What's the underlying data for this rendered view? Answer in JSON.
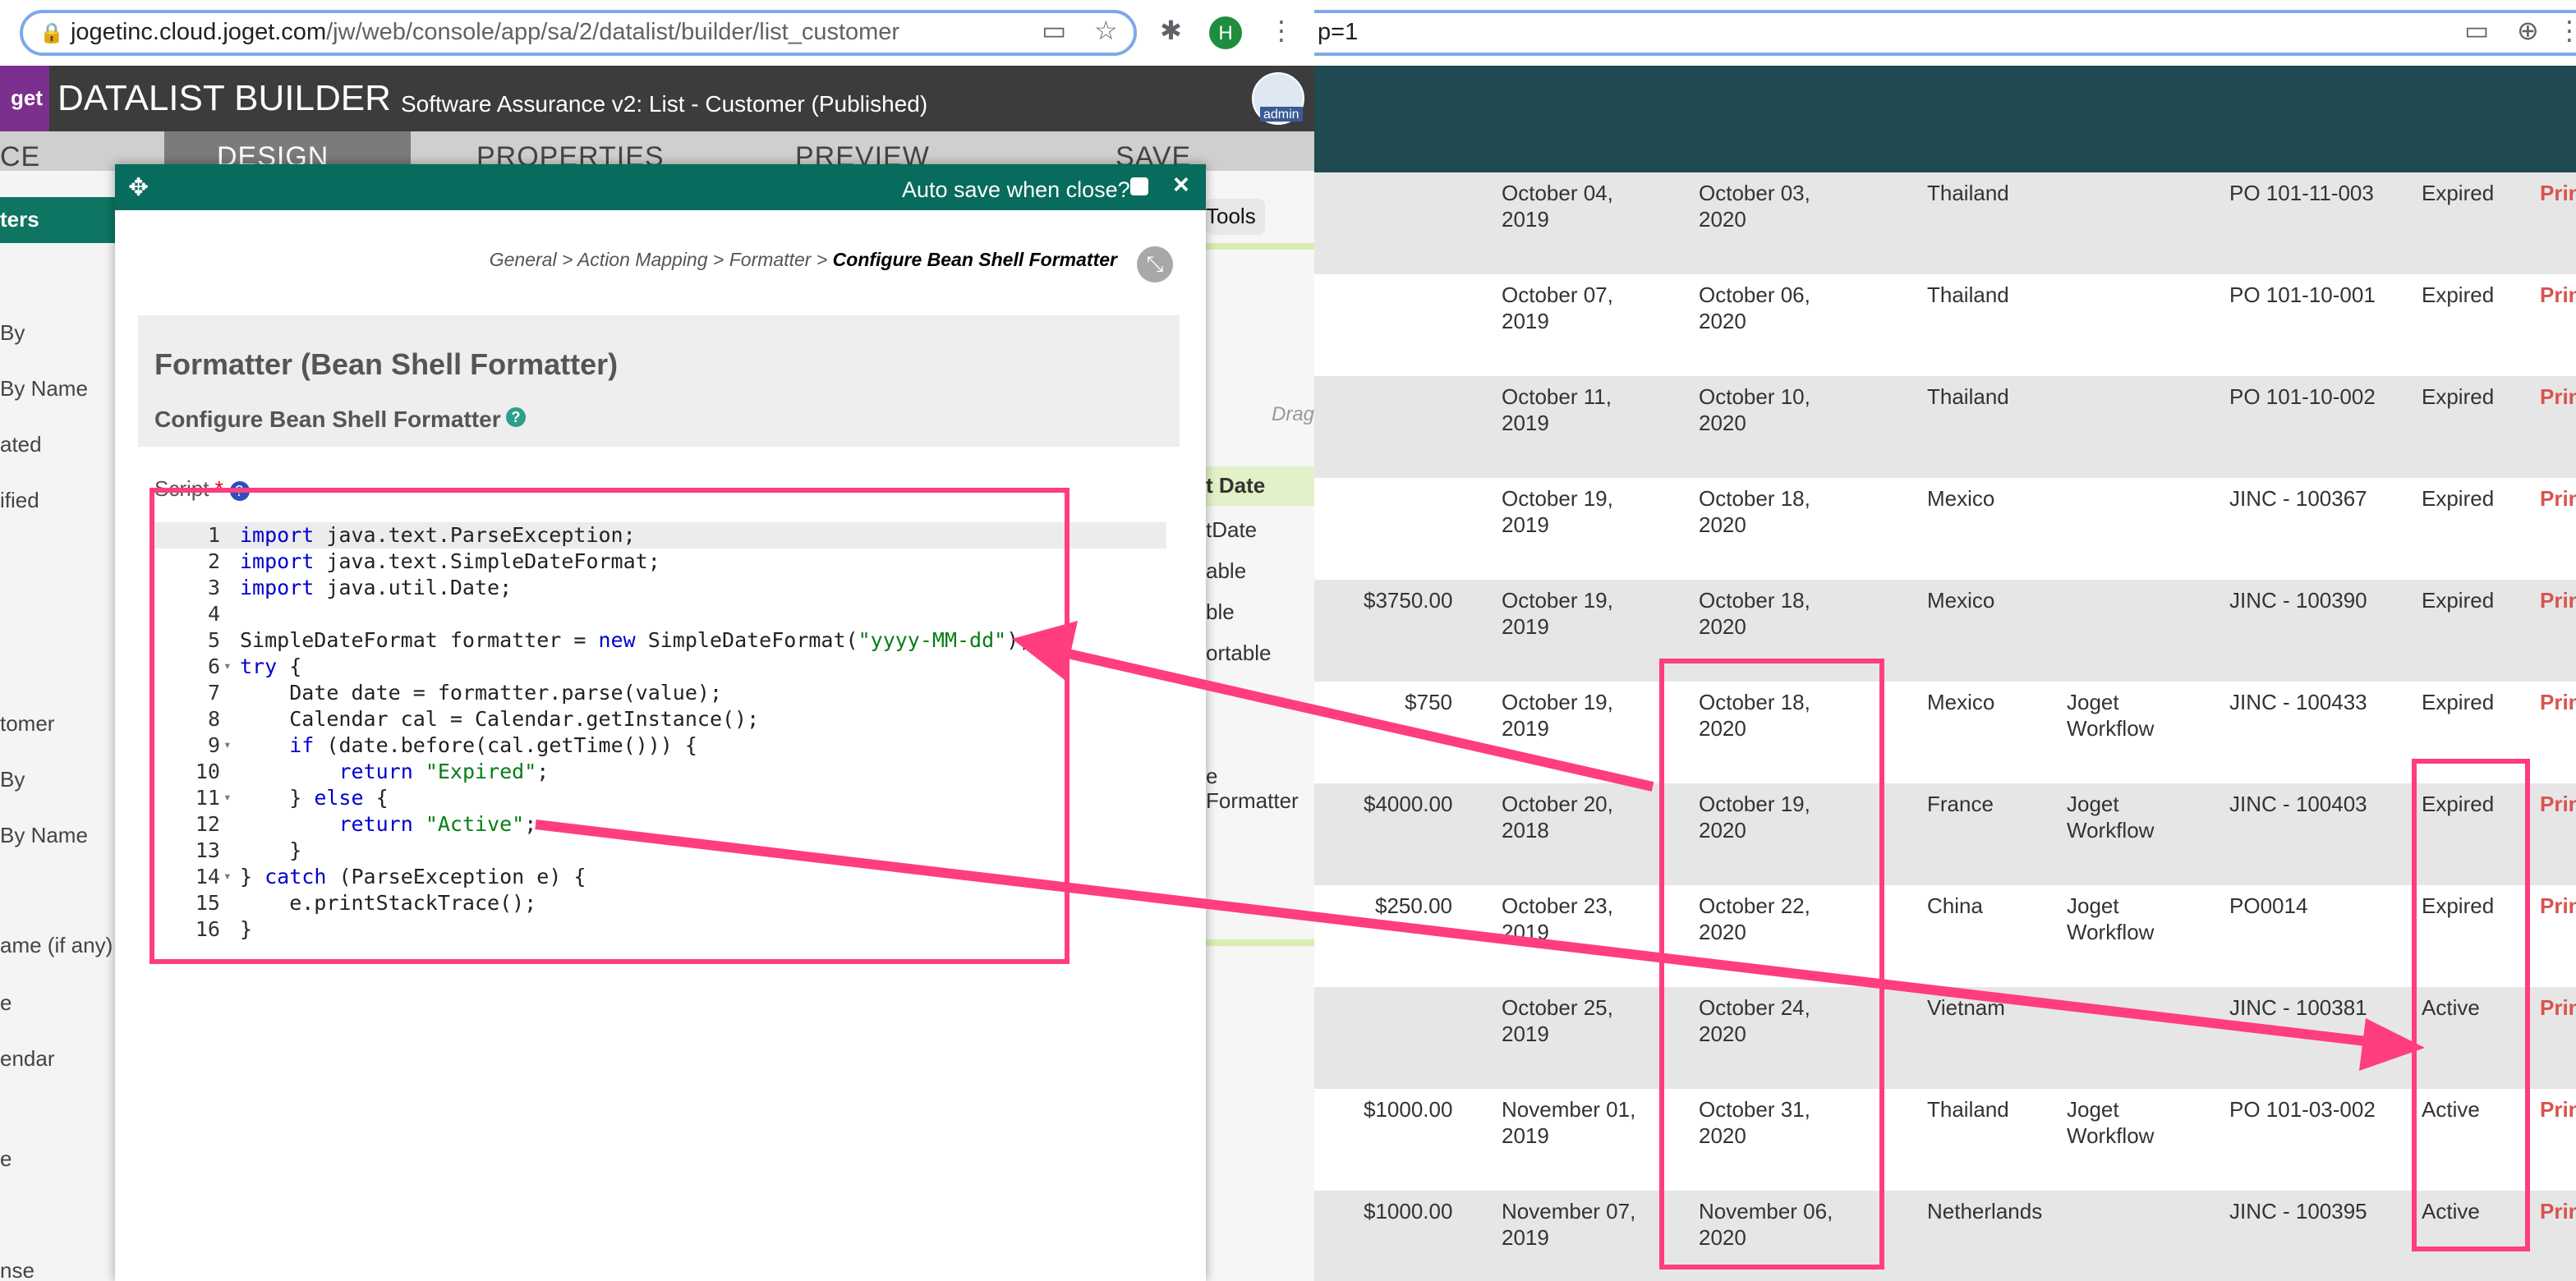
{
  "browser_left": {
    "url_host": "jogetinc.cloud.joget.com",
    "url_path": "/jw/web/console/app/sa/2/datalist/builder/list_customer",
    "profile_initial": "H"
  },
  "browser_right": {
    "url_fragment": "p=1"
  },
  "builder": {
    "logo_text": "get",
    "title": "DATALIST BUILDER",
    "subtitle": "Software Assurance v2: List - Customer (Published)",
    "avatar_label": "admin",
    "tabs": [
      "CE",
      "DESIGN",
      "PROPERTIES",
      "PREVIEW",
      "SAVE"
    ]
  },
  "sidebar": {
    "header": "ters",
    "items": [
      "By",
      "By Name",
      "ated",
      "ified",
      "tomer",
      "By",
      "By Name",
      "ame (if any)",
      "e",
      "endar",
      "e",
      "nse"
    ]
  },
  "middle": {
    "tools_label": "Tools",
    "drag_label": "Drag",
    "column_header": "t Date",
    "items": [
      "tDate",
      "able",
      "ble",
      "ortable"
    ],
    "formatter_label": "e Formatter"
  },
  "dialog": {
    "auto_save_label": "Auto save when close?",
    "close_label": "×",
    "breadcrumb": [
      "General",
      "Action Mapping",
      "Formatter"
    ],
    "breadcrumb_current": "Configure Bean Shell Formatter",
    "heading": "Formatter (Bean Shell Formatter)",
    "subheading": "Configure Bean Shell Formatter",
    "script_label": "Script",
    "code_lines": [
      "import java.text.ParseException;",
      "import java.text.SimpleDateFormat;",
      "import java.util.Date;",
      "",
      "SimpleDateFormat formatter = new SimpleDateFormat(\"yyyy-MM-dd\");",
      "try {",
      "    Date date = formatter.parse(value);",
      "    Calendar cal = Calendar.getInstance();",
      "    if (date.before(cal.getTime())) {",
      "        return \"Expired\";",
      "    } else {",
      "        return \"Active\";",
      "    }",
      "} catch (ParseException e) {",
      "    e.printStackTrace();",
      "}"
    ]
  },
  "table": {
    "print_label": "Prin",
    "rows": [
      {
        "amount": "",
        "start": "October 04, 2019",
        "end": "October 03, 2020",
        "country": "Thailand",
        "product": "",
        "po": "PO 101-11-003",
        "status": "Expired"
      },
      {
        "amount": "",
        "start": "October 07, 2019",
        "end": "October 06, 2020",
        "country": "Thailand",
        "product": "",
        "po": "PO 101-10-001",
        "status": "Expired"
      },
      {
        "amount": "",
        "start": "October 11, 2019",
        "end": "October 10, 2020",
        "country": "Thailand",
        "product": "",
        "po": "PO 101-10-002",
        "status": "Expired"
      },
      {
        "amount": "",
        "start": "October 19, 2019",
        "end": "October 18, 2020",
        "country": "Mexico",
        "product": "",
        "po": "JINC - 100367",
        "status": "Expired"
      },
      {
        "amount": "$3750.00",
        "start": "October 19, 2019",
        "end": "October 18, 2020",
        "country": "Mexico",
        "product": "",
        "po": "JINC - 100390",
        "status": "Expired"
      },
      {
        "amount": "$750",
        "start": "October 19, 2019",
        "end": "October 18, 2020",
        "country": "Mexico",
        "product": "Joget Workflow",
        "po": "JINC - 100433",
        "status": "Expired"
      },
      {
        "amount": "$4000.00",
        "start": "October 20, 2018",
        "end": "October 19, 2020",
        "country": "France",
        "product": "Joget Workflow",
        "po": "JINC - 100403",
        "status": "Expired"
      },
      {
        "amount": "$250.00",
        "start": "October 23, 2019",
        "end": "October 22, 2020",
        "country": "China",
        "product": "Joget Workflow",
        "po": "PO0014",
        "status": "Expired"
      },
      {
        "amount": "",
        "start": "October 25, 2019",
        "end": "October 24, 2020",
        "country": "Vietnam",
        "product": "",
        "po": "JINC - 100381",
        "status": "Active"
      },
      {
        "amount": "$1000.00",
        "start": "November 01, 2019",
        "end": "October 31, 2020",
        "country": "Thailand",
        "product": "Joget Workflow",
        "po": "PO 101-03-002",
        "status": "Active"
      },
      {
        "amount": "$1000.00",
        "start": "November 07, 2019",
        "end": "November 06, 2020",
        "country": "Netherlands",
        "product": "",
        "po": "JINC - 100395",
        "status": "Active"
      }
    ]
  },
  "colors": {
    "annotation": "#ff3d7f",
    "dialog_bar": "#076b5d",
    "header_dark": "#3c3c3c",
    "table_top": "#1f4a51"
  }
}
